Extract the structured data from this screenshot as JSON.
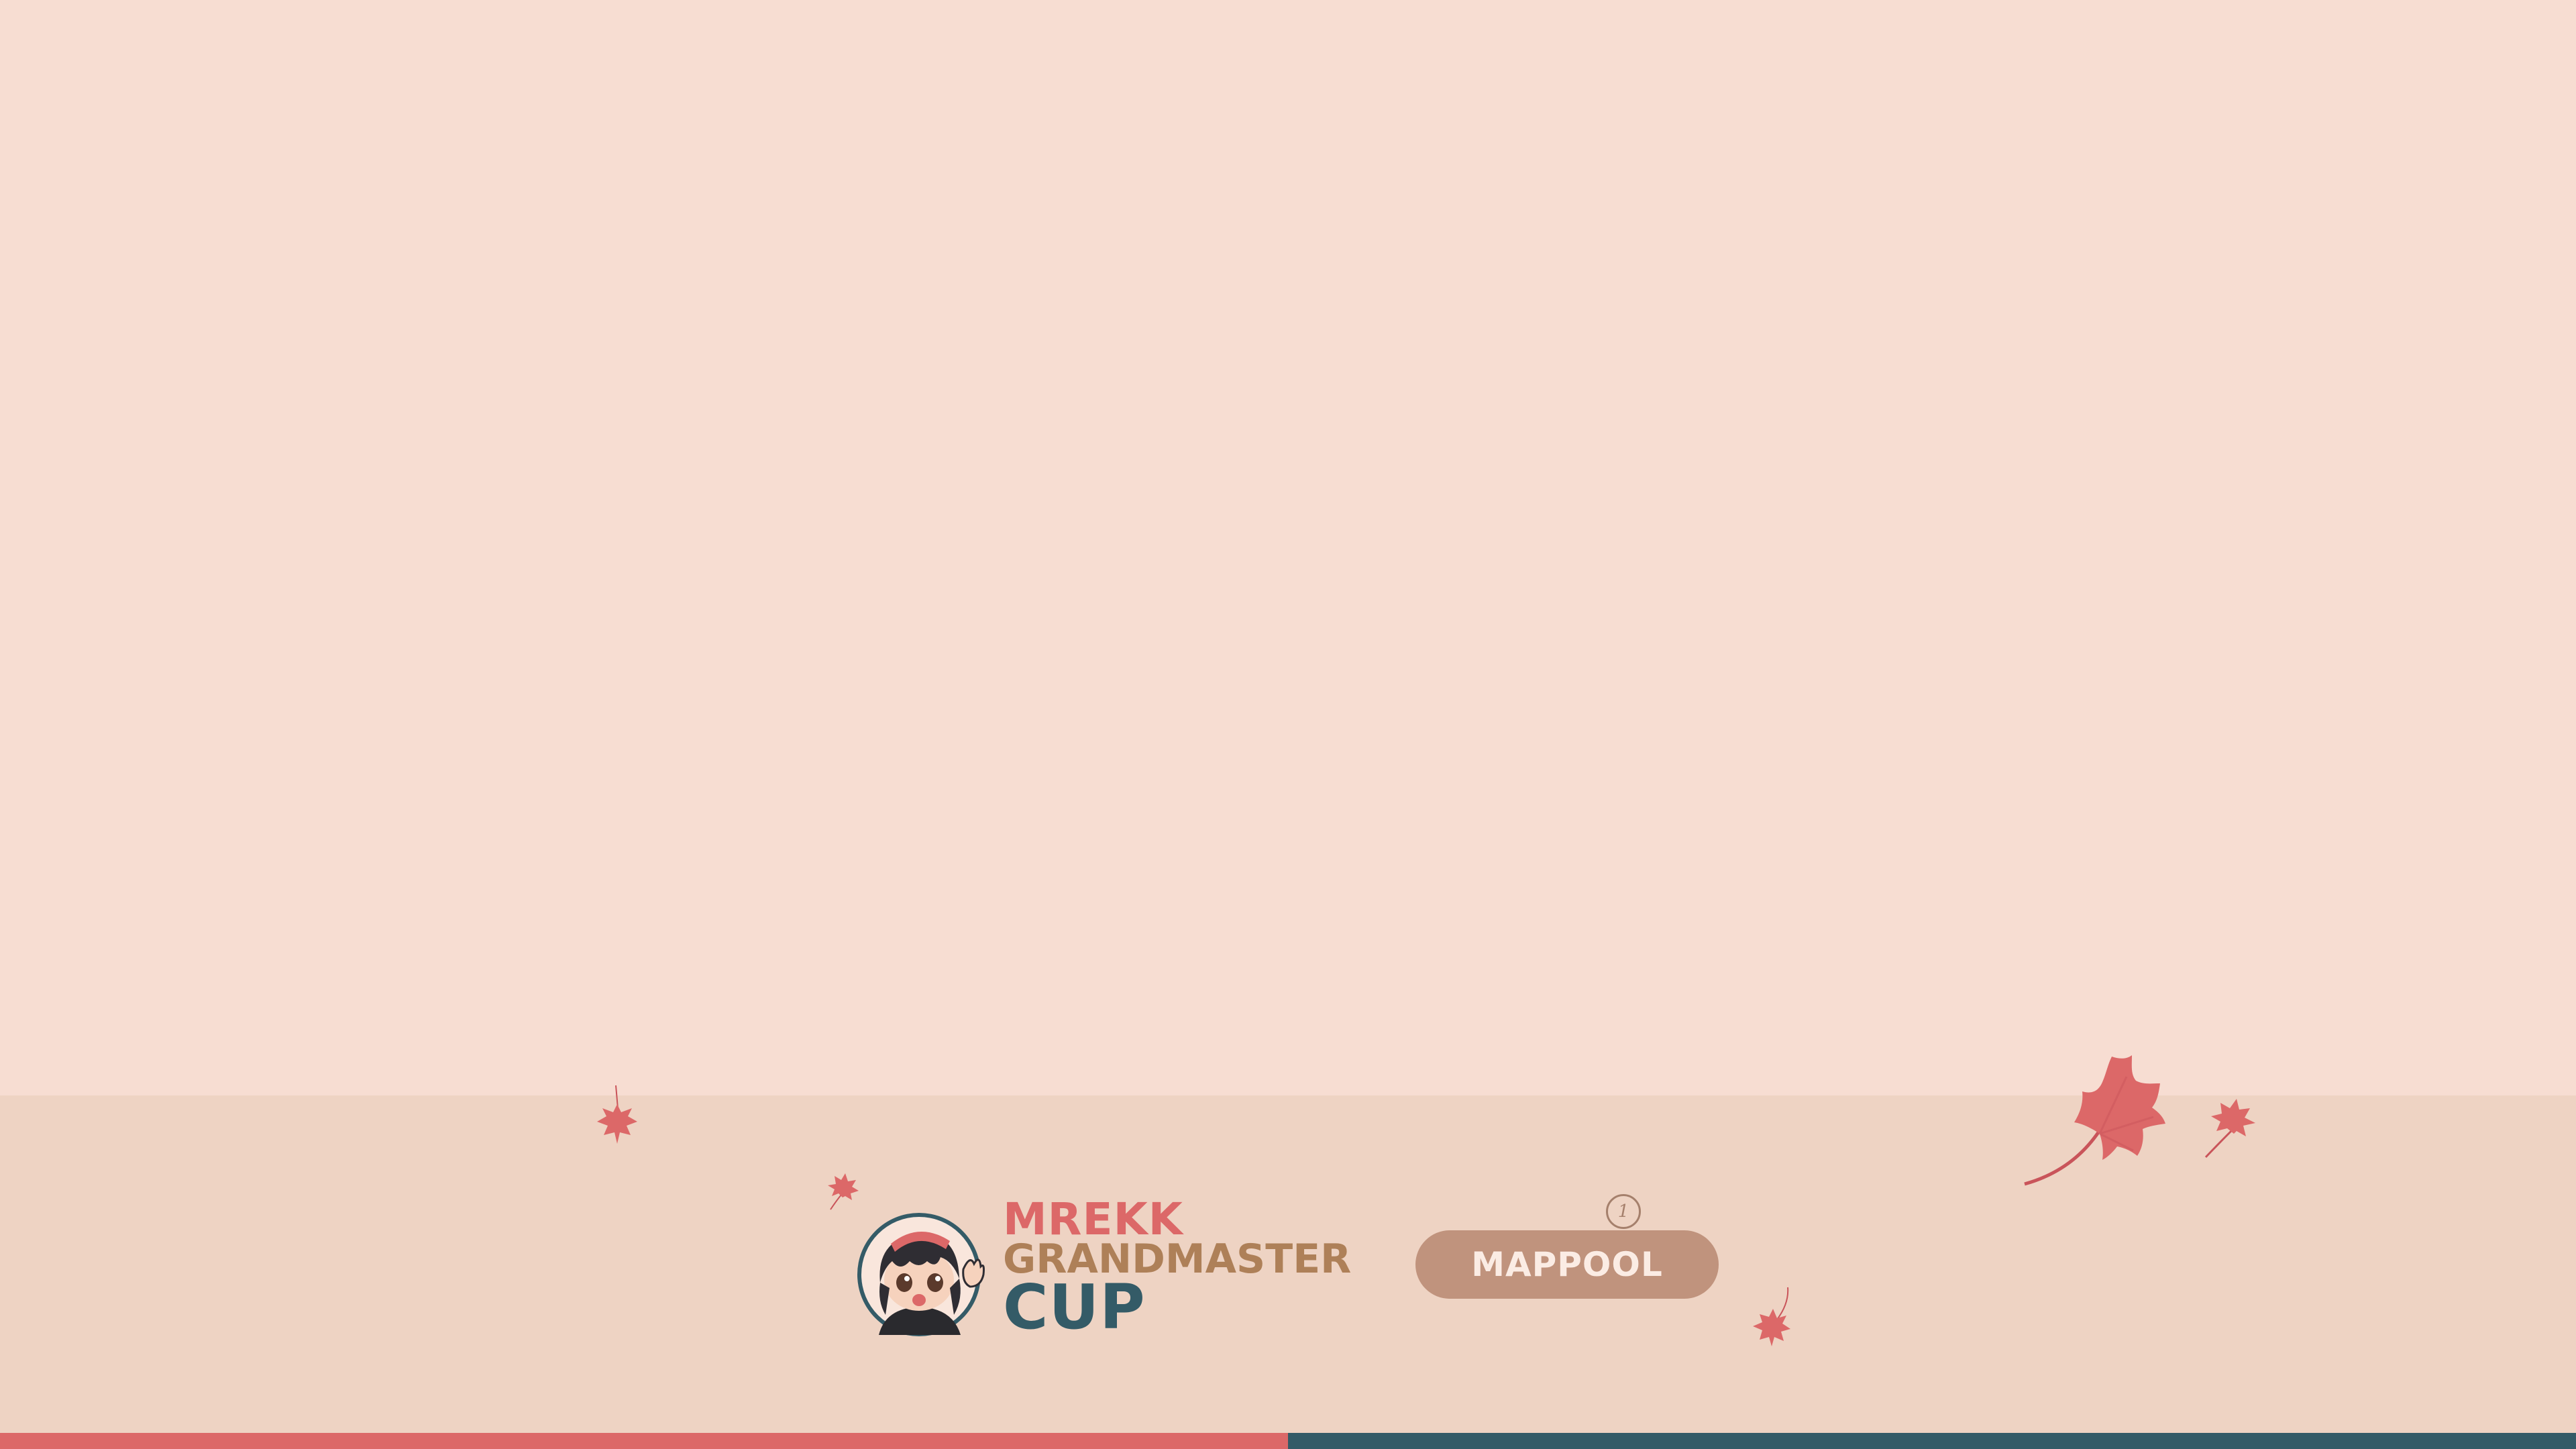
{
  "colors": {
    "stage_bg": "#f7ddd2",
    "footer_bg": "#eed3c3",
    "accent_red": "#dc6868",
    "accent_teal": "#345b67",
    "accent_gold": "#ae8058",
    "button_bg": "#c0937d",
    "button_text": "#fbece4",
    "badge_text": "#a5806c",
    "leaf": "#dc6868",
    "leaf_dark": "#c9545a"
  },
  "branding": {
    "line1": "MREKK",
    "line2": "GRANDMASTER",
    "line3": "CUP"
  },
  "footer": {
    "counter": "1",
    "mappool_label": "MAPPOOL"
  },
  "icons": {
    "avatar": "chibi-avatar-icon",
    "leaf": "maple-leaf-icon"
  }
}
